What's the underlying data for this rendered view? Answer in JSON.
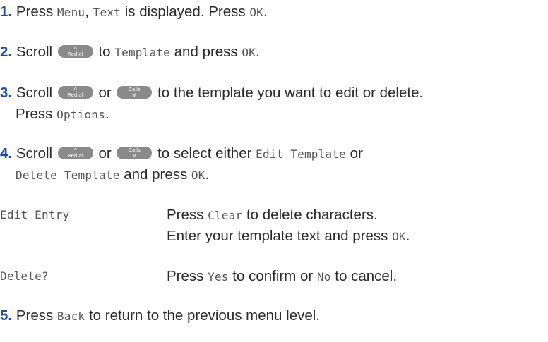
{
  "steps": [
    {
      "num": "1.",
      "parts": [
        "Press ",
        "Menu",
        ", ",
        "Text",
        " is displayed. Press ",
        "OK",
        "."
      ]
    },
    {
      "num": "2.",
      "parts": [
        "Scroll ",
        " to ",
        "Template",
        " and press ",
        "OK",
        "."
      ]
    },
    {
      "num": "3.",
      "line1": [
        "Scroll ",
        " or ",
        " to the template you want to edit or delete."
      ],
      "line2": [
        "Press ",
        "Options",
        "."
      ]
    },
    {
      "num": "4.",
      "line1": [
        "Scroll ",
        " or ",
        " to select either ",
        "Edit Template",
        " or"
      ],
      "line2": [
        "Delete Template",
        " and press ",
        "OK",
        "."
      ]
    },
    {
      "num": "5.",
      "parts": [
        "Press ",
        "Back",
        " to return to the previous menu level."
      ]
    }
  ],
  "keys": {
    "redial_label": "Redial",
    "redial_arrow": "^",
    "calls_label": "Calls",
    "calls_arrow": "v"
  },
  "table": [
    {
      "term": "Edit Entry",
      "line1": [
        "Press ",
        "Clear",
        " to delete characters."
      ],
      "line2": [
        "Enter your template text and press ",
        "OK",
        "."
      ]
    },
    {
      "term": "Delete?",
      "line1": [
        "Press ",
        "Yes",
        " to confirm or ",
        "No",
        " to cancel."
      ]
    }
  ],
  "colors": {
    "step_number": "#1f4e9a",
    "key_background": "#8a8a8a",
    "text": "#2a2a2a"
  }
}
